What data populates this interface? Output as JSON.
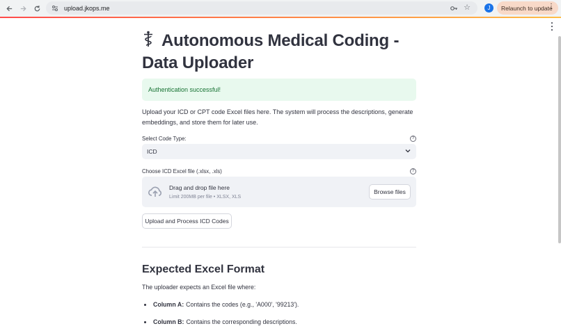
{
  "browser": {
    "url": "upload.jkops.me",
    "profile_initial": "J",
    "relaunch_label": "Relaunch to update"
  },
  "page": {
    "title": "Autonomous Medical Coding - Data Uploader",
    "alert": "Authentication successful!",
    "description": "Upload your ICD or CPT code Excel files here. The system will process the descriptions, generate embeddings, and store them for later use.",
    "code_type": {
      "label": "Select Code Type:",
      "selected": "ICD"
    },
    "file": {
      "label": "Choose ICD Excel file (.xlsx, .xls)",
      "drop_title": "Drag and drop file here",
      "drop_limit": "Limit 200MB per file • XLSX, XLS",
      "browse_label": "Browse files"
    },
    "upload_button": "Upload and Process ICD Codes",
    "format_section": {
      "heading": "Expected Excel Format",
      "intro": "The uploader expects an Excel file where:",
      "bullets": [
        {
          "term": "Column A:",
          "text": "Contains the codes (e.g., 'A000', '99213')."
        },
        {
          "term": "Column B:",
          "text": "Contains the corresponding descriptions."
        }
      ]
    }
  },
  "colors": {
    "accent_start": "#ff4b4b",
    "accent_end": "#ffbd45",
    "success_text": "#177233",
    "input_bg": "#f0f2f6"
  }
}
